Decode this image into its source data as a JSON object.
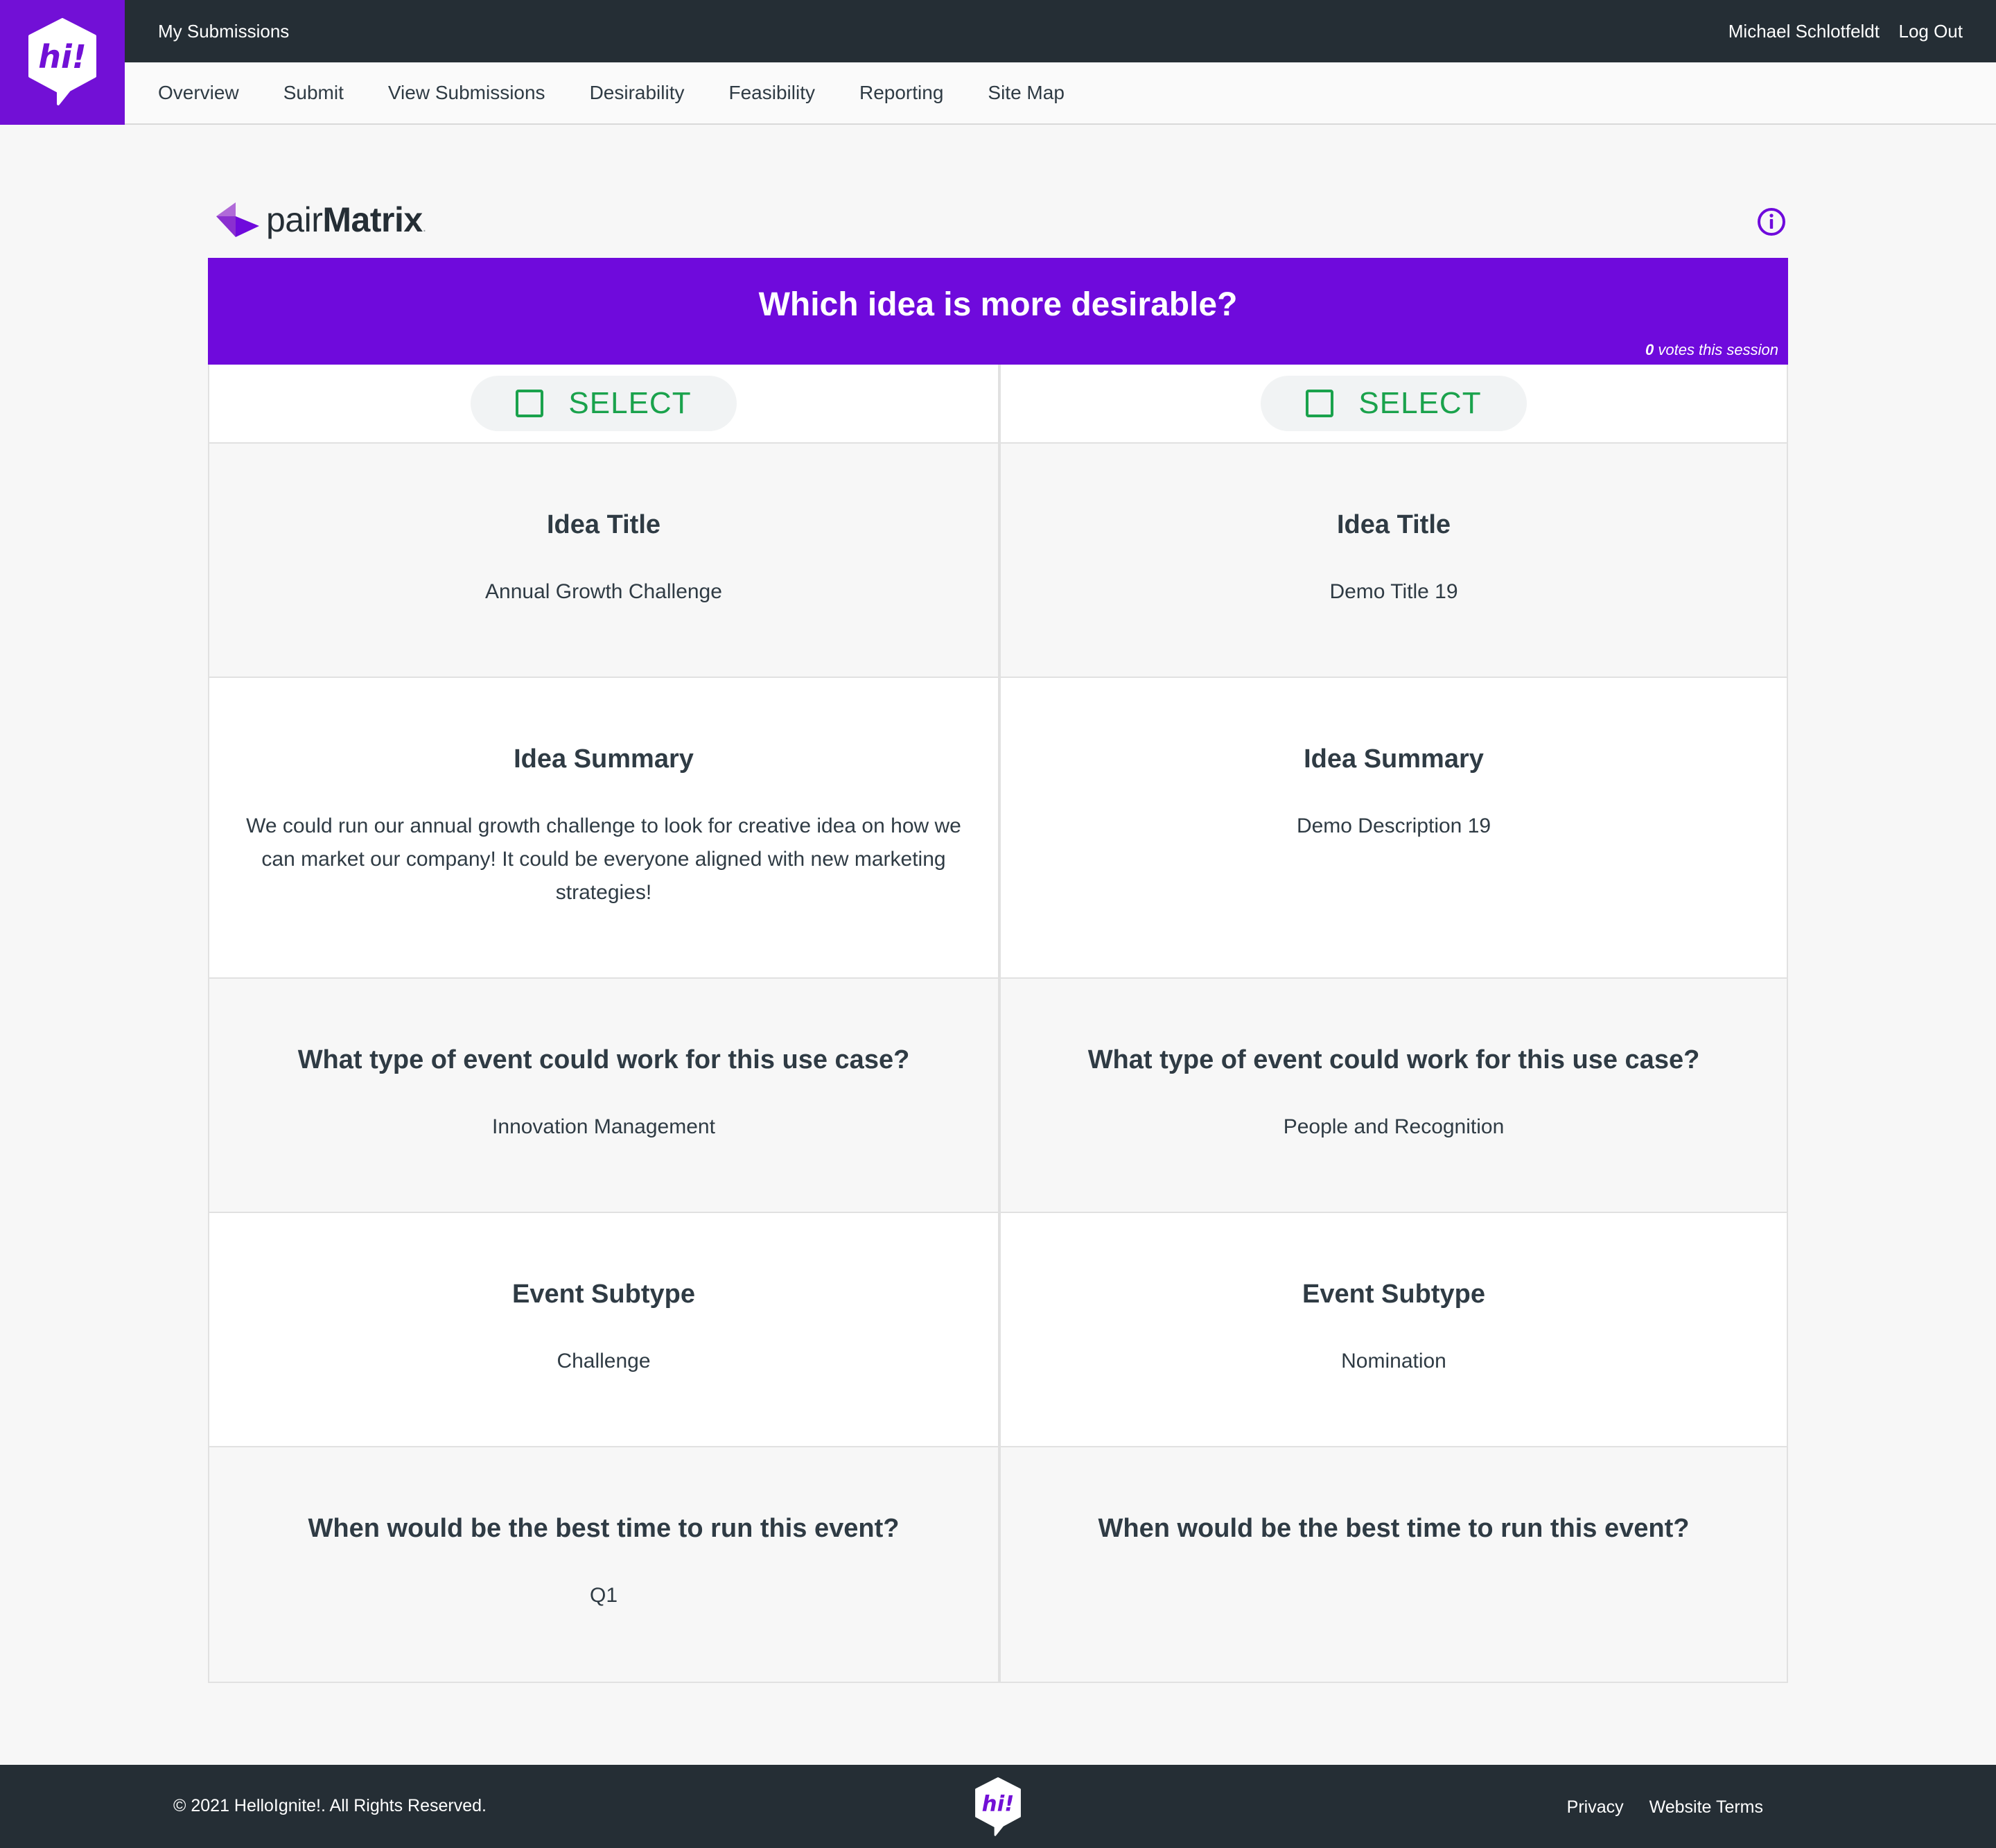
{
  "header": {
    "logo_text": "hi!",
    "my_submissions": "My Submissions",
    "user_name": "Michael Schlotfeldt",
    "logout": "Log Out",
    "nav": [
      "Overview",
      "Submit",
      "View Submissions",
      "Desirability",
      "Feasibility",
      "Reporting",
      "Site Map"
    ]
  },
  "brand": {
    "prefix": "pair",
    "name": "Matrix",
    "suffix": ".",
    "info_icon": "info-circle-icon"
  },
  "banner": {
    "question": "Which idea is more desirable?",
    "vote_count": "0",
    "vote_label": "votes this session"
  },
  "select_label": "SELECT",
  "ideas": [
    {
      "title_label": "Idea Title",
      "title": "Annual Growth Challenge",
      "summary_label": "Idea Summary",
      "summary": "We could run our annual growth challenge to look for creative idea on how we can market our company! It could be everyone aligned with new marketing strategies!",
      "event_type_label": "What type of event could work for this use case?",
      "event_type": "Innovation Management",
      "subtype_label": "Event Subtype",
      "subtype": "Challenge",
      "time_label": "When would be the best time to run this event?",
      "time": "Q1"
    },
    {
      "title_label": "Idea Title",
      "title": "Demo Title 19",
      "summary_label": "Idea Summary",
      "summary": "Demo Description 19",
      "event_type_label": "What type of event could work for this use case?",
      "event_type": "People and Recognition",
      "subtype_label": "Event Subtype",
      "subtype": "Nomination",
      "time_label": "When would be the best time to run this event?",
      "time": ""
    }
  ],
  "footer": {
    "copyright": "© 2021 HelloIgnite!. All Rights Reserved.",
    "privacy": "Privacy",
    "terms": "Website Terms"
  },
  "colors": {
    "brand_purple": "#6f0adc",
    "dark": "#252e35",
    "select_green": "#1aa24c"
  }
}
